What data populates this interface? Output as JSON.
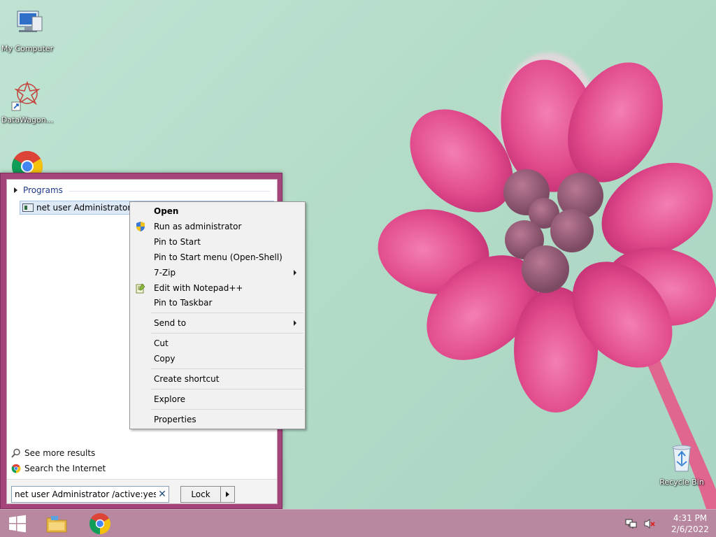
{
  "desktop": {
    "icons": [
      {
        "label": "My Computer",
        "icon": "computer-icon"
      },
      {
        "label": "DataWagon...",
        "icon": "datawagon-icon"
      },
      {
        "label": "",
        "icon": "chrome-icon"
      },
      {
        "label": "Recycle Bin",
        "icon": "recycle-bin-icon"
      }
    ]
  },
  "start_menu": {
    "programs_header": "Programs",
    "result_item": "net user Administrator /active:yes",
    "see_more": "See more results",
    "search_internet": "Search the Internet",
    "search_value": "net user Administrator /active:yes",
    "lock_label": "Lock"
  },
  "context_menu": {
    "items": [
      {
        "label": "Open",
        "bold": true,
        "icon": "",
        "submenu": false
      },
      {
        "label": "Run as administrator",
        "icon": "uac-shield-icon",
        "submenu": false
      },
      {
        "label": "Pin to Start",
        "icon": "",
        "submenu": false
      },
      {
        "label": "Pin to Start menu (Open-Shell)",
        "icon": "",
        "submenu": false
      },
      {
        "label": "7-Zip",
        "icon": "",
        "submenu": true
      },
      {
        "label": "Edit with Notepad++",
        "icon": "notepad-plus-plus-icon",
        "submenu": false
      },
      {
        "label": "Pin to Taskbar",
        "icon": "",
        "submenu": false
      },
      {
        "label": "Send to",
        "icon": "",
        "submenu": true
      },
      {
        "label": "Cut",
        "icon": "",
        "submenu": false
      },
      {
        "label": "Copy",
        "icon": "",
        "submenu": false
      },
      {
        "label": "Create shortcut",
        "icon": "",
        "submenu": false
      },
      {
        "label": "Explore",
        "icon": "",
        "submenu": false
      },
      {
        "label": "Properties",
        "icon": "",
        "submenu": false
      }
    ]
  },
  "taskbar": {
    "time": "4:31 PM",
    "date": "2/6/2022"
  },
  "colors": {
    "start_menu_frame": "#a5447a",
    "taskbar": "#b7889f",
    "wallpaper": "#bfe3d3",
    "flower": "#e0558f"
  }
}
